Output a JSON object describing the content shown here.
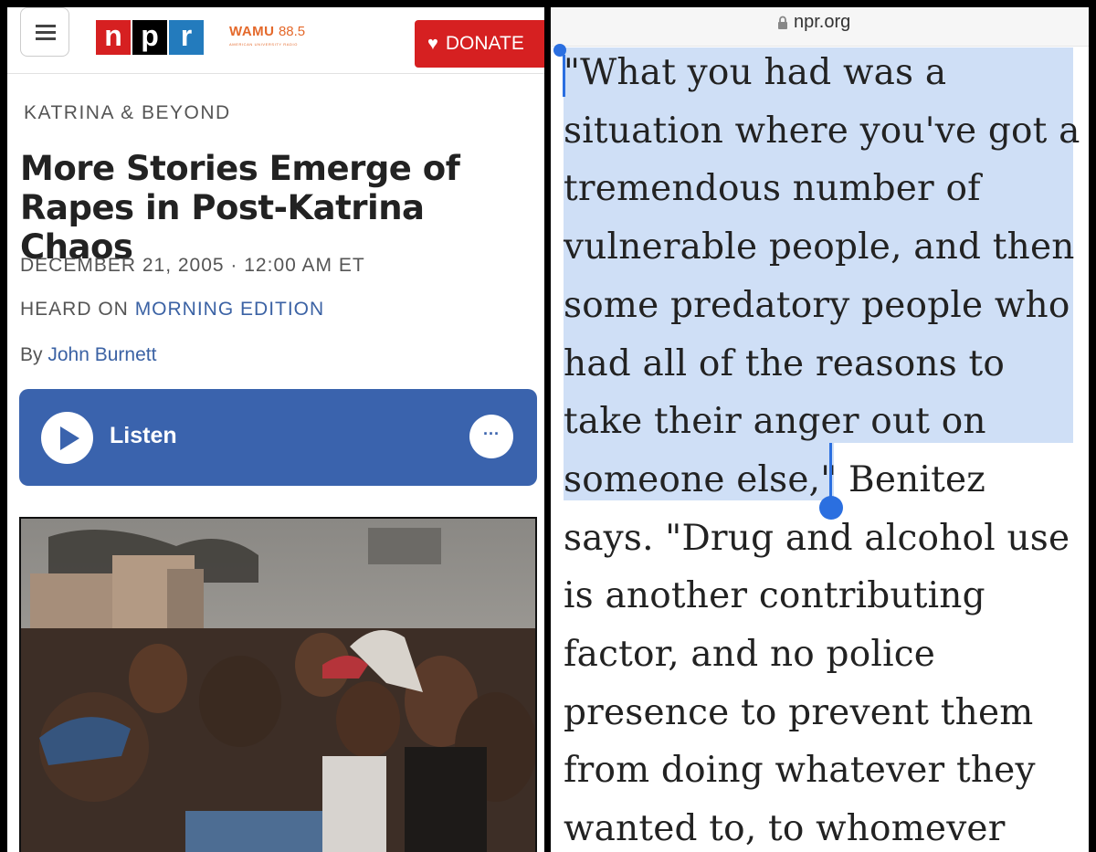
{
  "left": {
    "header": {
      "logo_letters": [
        "n",
        "p",
        "r"
      ],
      "station_name": "WAMU",
      "station_freq": "88.5",
      "station_sub": "AMERICAN UNIVERSITY RADIO",
      "donate_label": "DONATE"
    },
    "article": {
      "section": "KATRINA & BEYOND",
      "title": "More Stories Emerge of Rapes in Post-Katrina Chaos",
      "dateline": "DECEMBER 21, 2005 · 12:00 AM ET",
      "heard_prefix": "HEARD ON ",
      "heard_program": "MORNING EDITION",
      "by_prefix": "By ",
      "author": "John Burnett"
    },
    "player": {
      "listen_label": "Listen",
      "more_label": "···"
    },
    "photo": {
      "description_icon": "news-photo"
    }
  },
  "right": {
    "browser": {
      "url": "npr.org"
    },
    "lines": [
      "\"What you had was a",
      "situation where you've got a",
      "tremendous number of",
      "vulnerable people, and then",
      "some predatory people who",
      "had all of the reasons to",
      "take their anger out on",
      "someone else,\" Benitez",
      "says. \"Drug and alcohol use",
      "is another contributing",
      "factor, and no police",
      "presence to prevent them",
      "from doing whatever they",
      "wanted to, to whomever"
    ],
    "selection_color": "#cfdff6"
  },
  "colors": {
    "npr_red": "#d62021",
    "npr_blue": "#237bbd",
    "player_blue": "#3a63ad",
    "link_blue": "#3b62a4",
    "wamu_orange": "#e4692b",
    "selection_handle": "#2b6fe0"
  }
}
